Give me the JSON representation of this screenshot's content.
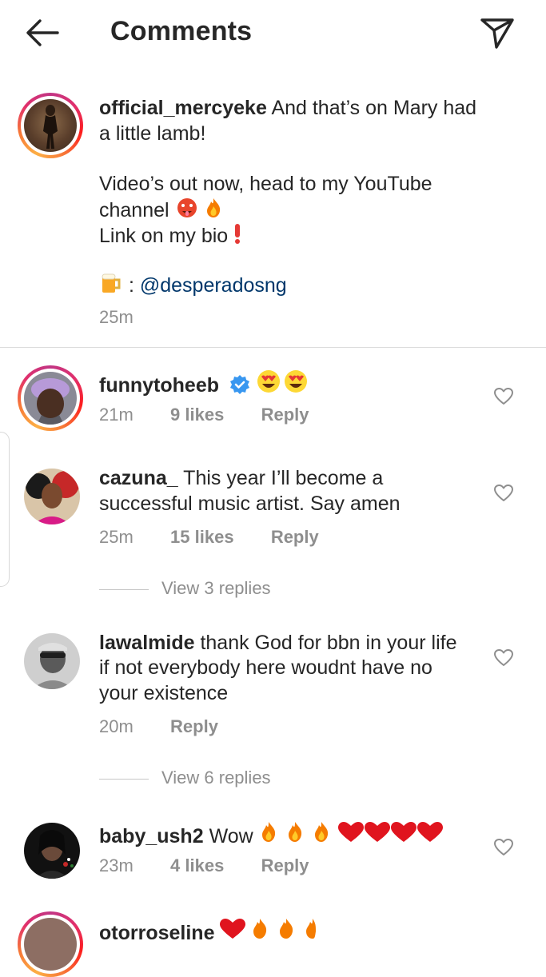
{
  "header": {
    "title": "Comments"
  },
  "caption": {
    "username": "official_mercyeke",
    "line1": "And that’s on Mary had",
    "line2": "a little lamb!",
    "line3": "Video’s out now, head to my YouTube",
    "line4": "channel",
    "line5": "Link on my bio",
    "beer_prefix": ":",
    "mention": "@desperadosng",
    "time": "25m"
  },
  "comments": [
    {
      "username": "funnytoheeb",
      "verified": true,
      "time": "21m",
      "likes": "9 likes",
      "reply": "Reply"
    },
    {
      "username": "cazuna_",
      "line1": "This year I’ll become a",
      "line2": "successful music artist. Say amen",
      "time": "25m",
      "likes": "15 likes",
      "reply": "Reply",
      "view_replies": "View 3 replies"
    },
    {
      "username": "lawalmide",
      "line1": "thank God for bbn in your life",
      "line2": "if not everybody here woudnt have no",
      "line3": "your existence",
      "time": "20m",
      "reply": "Reply",
      "view_replies": "View 6 replies"
    },
    {
      "username": "baby_ush2",
      "line1": "Wow",
      "time": "23m",
      "likes": "4 likes",
      "reply": "Reply"
    },
    {
      "username": "otorroseline"
    }
  ],
  "icons": {
    "back": "arrow-left-icon",
    "send": "paper-plane-icon",
    "like": "heart-outline-icon",
    "verified": "verified-badge-icon"
  },
  "colors": {
    "mention": "#00376b",
    "meta": "#8e8e8e",
    "verified": "#3897f0",
    "heart_red": "#ed4956",
    "ring": "#e1306c"
  }
}
